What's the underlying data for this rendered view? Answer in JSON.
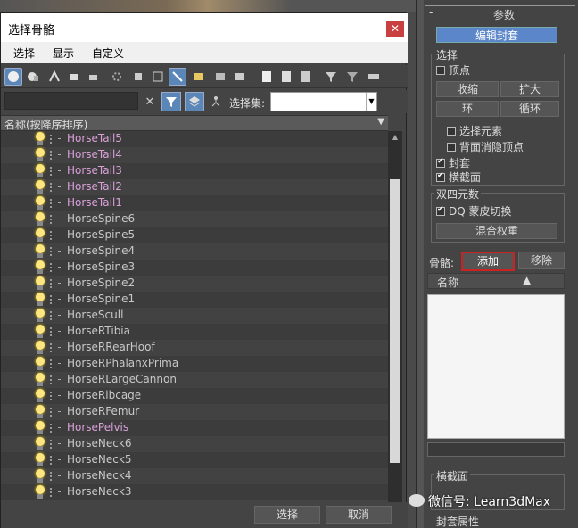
{
  "dialog": {
    "title": "选择骨骼",
    "close_glyph": "✕",
    "menu": [
      "选择",
      "显示",
      "自定义"
    ],
    "filter": {
      "clear_glyph": "✕",
      "selection_set_label": "选择集:",
      "selection_set_value": ""
    },
    "column_header": "名称(按降序排序)",
    "items": [
      {
        "label": "HorseTail5",
        "color": "#d9a0d9"
      },
      {
        "label": "HorseTail4",
        "color": "#d9a0d9"
      },
      {
        "label": "HorseTail3",
        "color": "#d9a0d9"
      },
      {
        "label": "HorseTail2",
        "color": "#d9a0d9"
      },
      {
        "label": "HorseTail1",
        "color": "#d9a0d9"
      },
      {
        "label": "HorseSpine6",
        "color": "#c8c8c8"
      },
      {
        "label": "HorseSpine5",
        "color": "#c8c8c8"
      },
      {
        "label": "HorseSpine4",
        "color": "#c8c8c8"
      },
      {
        "label": "HorseSpine3",
        "color": "#c8c8c8"
      },
      {
        "label": "HorseSpine2",
        "color": "#c8c8c8"
      },
      {
        "label": "HorseSpine1",
        "color": "#c8c8c8"
      },
      {
        "label": "HorseScull",
        "color": "#c8c8c8"
      },
      {
        "label": "HorseRTibia",
        "color": "#c8c8c8"
      },
      {
        "label": "HorseRRearHoof",
        "color": "#c8c8c8"
      },
      {
        "label": "HorseRPhalanxPrima",
        "color": "#c8c8c8"
      },
      {
        "label": "HorseRLargeCannon",
        "color": "#c8c8c8"
      },
      {
        "label": "HorseRibcage",
        "color": "#c8c8c8"
      },
      {
        "label": "HorseRFemur",
        "color": "#c8c8c8"
      },
      {
        "label": "HorsePelvis",
        "color": "#d9a0d9"
      },
      {
        "label": "HorseNeck6",
        "color": "#c8c8c8"
      },
      {
        "label": "HorseNeck5",
        "color": "#c8c8c8"
      },
      {
        "label": "HorseNeck4",
        "color": "#c8c8c8"
      },
      {
        "label": "HorseNeck3",
        "color": "#c8c8c8"
      }
    ],
    "buttons": {
      "select": "选择",
      "cancel": "取消"
    }
  },
  "panel": {
    "rollout_minus": "-",
    "rollout_title": "参数",
    "edit_envelope": "编辑封套",
    "selection": {
      "title": "选择",
      "vertex": "顶点",
      "shrink": "收缩",
      "grow": "扩大",
      "ring": "环",
      "loop": "循环",
      "select_element": "选择元素",
      "backface_cull": "背面消隐顶点",
      "envelope": "封套",
      "cross_section": "横截面"
    },
    "dual_quat": {
      "title": "双四元数",
      "dq_skinning": "DQ 蒙皮切换",
      "blend_weights": "混合权重"
    },
    "bones": {
      "label": "骨骼:",
      "add": "添加",
      "remove": "移除",
      "name_header": "名称",
      "sort_glyph": "▲"
    },
    "cross_section_group": "横截面",
    "envelope_props": "封套属性"
  },
  "watermark": "微信号: Learn3dMax"
}
